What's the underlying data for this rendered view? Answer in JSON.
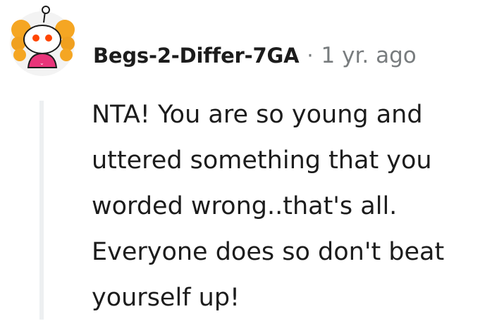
{
  "comment": {
    "username": "Begs-2-Differ-7GA",
    "separator": "·",
    "timestamp": "1 yr. ago",
    "avatar_icon": "snoo-avatar-icon",
    "body_lines": [
      "NTA! You are so young and",
      "uttered something that you",
      "worded wrong..that's all.",
      "Everyone does so don't beat",
      "yourself up!"
    ]
  },
  "colors": {
    "username": "#1c1c1c",
    "meta": "#787c7e",
    "thread_line": "#edeff1",
    "avatar_hair": "#f5a623",
    "avatar_shirt": "#e8357a",
    "avatar_eyes": "#ff4500"
  }
}
